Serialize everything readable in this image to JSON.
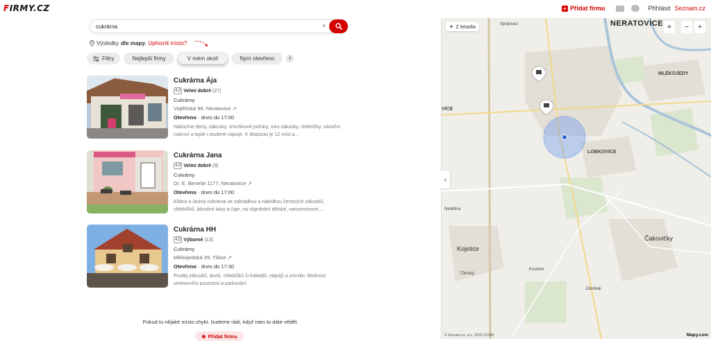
{
  "header": {
    "logo": "Firmy.cz",
    "logo_first": "F",
    "logo_rest": "IRMY.CZ",
    "add_firm": "Přidat firmu",
    "login": "Přihlásit",
    "seznam": "Seznam.cz"
  },
  "search": {
    "value": "cukrárna",
    "clear": "×"
  },
  "results_source": {
    "prefix": "Výsledky",
    "bold": "dle mapy.",
    "refine": "Upřesnit místo?"
  },
  "filters": [
    {
      "label": "Filtry"
    },
    {
      "label": "Nejlepší firmy"
    },
    {
      "label": "V mém okolí"
    },
    {
      "label": "Nyní otevřeno"
    },
    {
      "label": "i"
    }
  ],
  "results": [
    {
      "title": "Cukrárna Ája",
      "score": "4,3",
      "rating_text": "Velmi dobré",
      "rating_count": "(27)",
      "category": "Cukrárny",
      "address": "Vojtěšská 99, Neratovice",
      "open_label": "Otevřeno",
      "open_hours": "· dnes do 17:00",
      "description": "Nabízíme dorty, zákusky, zmrzlinové poháry, mini zákusky, chlebíčky, vánoční cukroví a teplé i studené nápoje. K dispozici je 12 míst a..."
    },
    {
      "title": "Cukrárna Jana",
      "score": "4,3",
      "rating_text": "Velmi dobré",
      "rating_count": "(9)",
      "category": "Cukrárny",
      "address": "Dr. E. Beneše 1177, Neratovice",
      "open_label": "Otevřeno",
      "open_hours": "· dnes do 17:00",
      "description": "Klidná a útulná cukrárna se zahrádkou a nabídkou čerstvých zákusků, chlebíčků, lahodné kávy a čaje, na objednání dětské, narozeninové,..."
    },
    {
      "title": "Cukrárna HH",
      "score": "4,5",
      "rating_text": "Výborné",
      "rating_count": "(13)",
      "category": "Cukrárny",
      "address": "Mlékojedská 39, Tišice",
      "open_label": "Otevřeno",
      "open_hours": "· dnes do 17:30",
      "description": "Prodej zákusků, dortů, chlebíčků či koktejlů, nápojů a zmrzlin. Možnost venkovního posezení a parkování."
    }
  ],
  "footer": {
    "note": "Pokud tu nějaké místo chybí, budeme rádi, když nám to dáte vědět.",
    "add_firm": "Přidat firmu"
  },
  "map": {
    "zletadla": "Z letadla",
    "zoom_out": "−",
    "zoom_in": "+",
    "labels": {
      "neratovice": "NERATOVICE",
      "mlekojedy": "MLÉKOJEDY",
      "lobkovice": "LOBKOVICE",
      "kojetice": "Kojetice",
      "cakovicky": "Čakovičky",
      "vice": "VICE",
      "spojovaci": "Spojovací",
      "nedetice": "Nedětice",
      "kostelni": "Kostelní",
      "tomsky": "Tůmský",
      "zdenek": "Zdonkak"
    },
    "copyright": "© Seznam.cz, a.s., 2025 ©OSM",
    "logo": "Mapy.com"
  },
  "colors": {
    "accent": "#d40000",
    "map_bg": "#efeee9",
    "water": "#a9c4d8",
    "road": "#f3d88a"
  }
}
